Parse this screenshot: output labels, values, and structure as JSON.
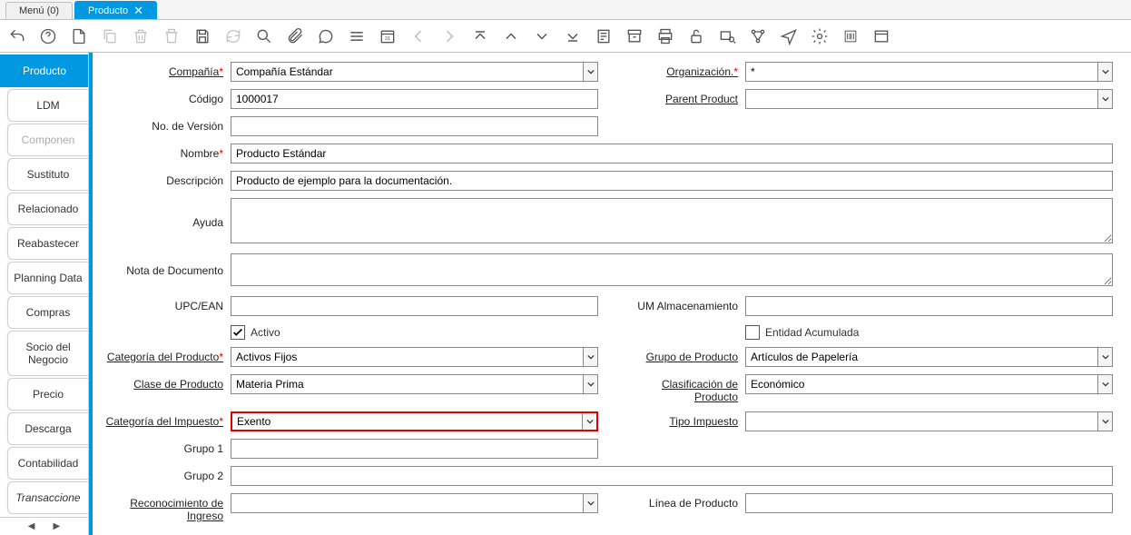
{
  "tabs": {
    "menu": "Menú (0)",
    "active": "Producto"
  },
  "sidebar": {
    "items": [
      "Producto",
      "LDM",
      "Componen",
      "Sustituto",
      "Relacionado",
      "Reabastecer",
      "Planning Data",
      "Compras",
      "Socio del Negocio",
      "Precio",
      "Descarga",
      "Contabilidad",
      "Transaccione"
    ]
  },
  "form": {
    "labels": {
      "compania": "Compañía",
      "organizacion": "Organización.",
      "codigo": "Código",
      "parent_product": "Parent Product",
      "no_version": "No. de Versión",
      "nombre": "Nombre",
      "descripcion": "Descripción",
      "ayuda": "Ayuda",
      "nota_documento": "Nota de Documento",
      "upc_ean": "UPC/EAN",
      "um_almacenamiento": "UM Almacenamiento",
      "activo": "Activo",
      "entidad_acumulada": "Entidad Acumulada",
      "categoria_producto": "Categoría del Producto",
      "grupo_producto": "Grupo de Producto",
      "clase_producto": "Clase de Producto",
      "clasificacion_producto": "Clasificación de Producto",
      "categoria_impuesto": "Categoría del Impuesto",
      "tipo_impuesto": "Tipo Impuesto",
      "grupo1": "Grupo 1",
      "grupo2": "Grupo 2",
      "reconocimiento_ingreso": "Reconocimiento de Ingreso",
      "linea_producto": "Línea de Producto"
    },
    "values": {
      "compania": "Compañía Estándar",
      "organizacion": "*",
      "codigo": "1000017",
      "parent_product": "",
      "no_version": "",
      "nombre": "Producto Estándar",
      "descripcion": "Producto de ejemplo para la documentación.",
      "ayuda": "",
      "nota_documento": "",
      "upc_ean": "",
      "um_almacenamiento": "",
      "activo_checked": true,
      "entidad_acumulada_checked": false,
      "categoria_producto": "Activos Fijos",
      "grupo_producto": "Artículos de Papelería",
      "clase_producto": "Materia Prima",
      "clasificacion_producto": "Económico",
      "categoria_impuesto": "Exento",
      "tipo_impuesto": "",
      "grupo1": "",
      "grupo2": "",
      "reconocimiento_ingreso": "",
      "linea_producto": ""
    }
  }
}
